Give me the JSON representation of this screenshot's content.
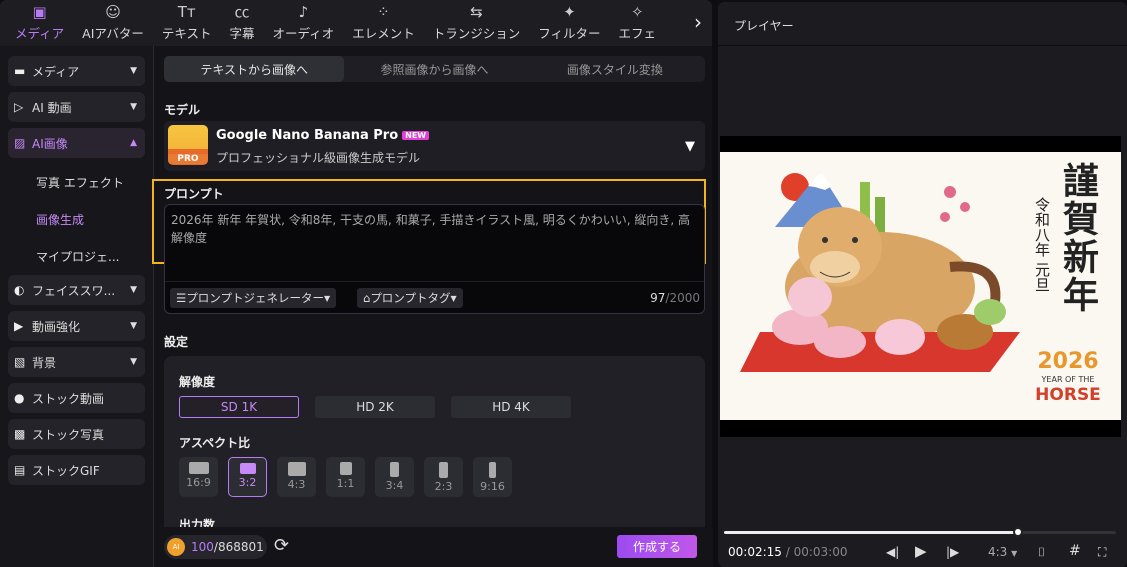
{
  "topnav": {
    "items": [
      {
        "label": "メディア",
        "icon": "media-icon",
        "glyph": "▣",
        "active": true
      },
      {
        "label": "AIアバター",
        "icon": "avatar-icon",
        "glyph": "☺"
      },
      {
        "label": "テキスト",
        "icon": "text-icon",
        "glyph": "Tт"
      },
      {
        "label": "字幕",
        "icon": "caption-icon",
        "glyph": "㏄"
      },
      {
        "label": "オーディオ",
        "icon": "audio-icon",
        "glyph": "♪"
      },
      {
        "label": "エレメント",
        "icon": "element-icon",
        "glyph": "⁘"
      },
      {
        "label": "トランジション",
        "icon": "transition-icon",
        "glyph": "⇆"
      },
      {
        "label": "フィルター",
        "icon": "filter-icon",
        "glyph": "✦"
      },
      {
        "label": "エフェ",
        "icon": "effect-icon",
        "glyph": "✧"
      }
    ],
    "next": "›"
  },
  "sidebar": {
    "media": "メディア",
    "ai_video": "AI 動画",
    "ai_image": "AI画像",
    "sub": [
      "写真 エフェクト",
      "画像生成",
      "マイプロジェ..."
    ],
    "face_swap": "フェイススワ...",
    "enhance": "動画強化",
    "background": "背景",
    "stock_video": "ストック動画",
    "stock_photo": "ストック写真",
    "stock_gif": "ストックGIF"
  },
  "tabs": [
    "テキストから画像へ",
    "参照画像から画像へ",
    "画像スタイル変換"
  ],
  "model": {
    "label": "モデル",
    "name": "Google Nano Banana Pro",
    "badge": "NEW",
    "icon_text": "PRO",
    "description": "プロフェッショナル級画像生成モデル"
  },
  "prompt": {
    "label": "プロンプト",
    "value": "2026年 新年 年賀状, 令和8年, 干支の馬, 和菓子, 手描きイラスト風, 明るくかわいい, 縦向き, 高解像度",
    "generator": "プロンプトジェネレーター",
    "tags": "プロンプトタグ",
    "count": "97",
    "max": "/2000"
  },
  "settings": {
    "label": "設定",
    "resolution_label": "解像度",
    "resolutions": [
      "SD 1K",
      "HD 2K",
      "HD 4K"
    ],
    "selected_resolution": "SD 1K",
    "aspect_label": "アスペクト比",
    "aspects": [
      "16:9",
      "3:2",
      "4:3",
      "1:1",
      "3:4",
      "2:3",
      "9:16"
    ],
    "selected_aspect": "3:2",
    "output_label": "出力数"
  },
  "footer": {
    "credits_used": "100",
    "credits_total": "/868801",
    "coin": "AI",
    "create": "作成する"
  },
  "player": {
    "title": "プレイヤー",
    "current": "00:02:15",
    "total": " / 00:03:00",
    "progress": 0.75,
    "ratio": "4:3",
    "image_text": {
      "greeting": "謹賀新年",
      "date": "令和八年 元旦",
      "year": "2026",
      "caption1": "YEAR OF THE",
      "caption2": "HORSE"
    }
  },
  "colors": {
    "accent": "#b77cf5",
    "highlight": "#f2b51c"
  }
}
